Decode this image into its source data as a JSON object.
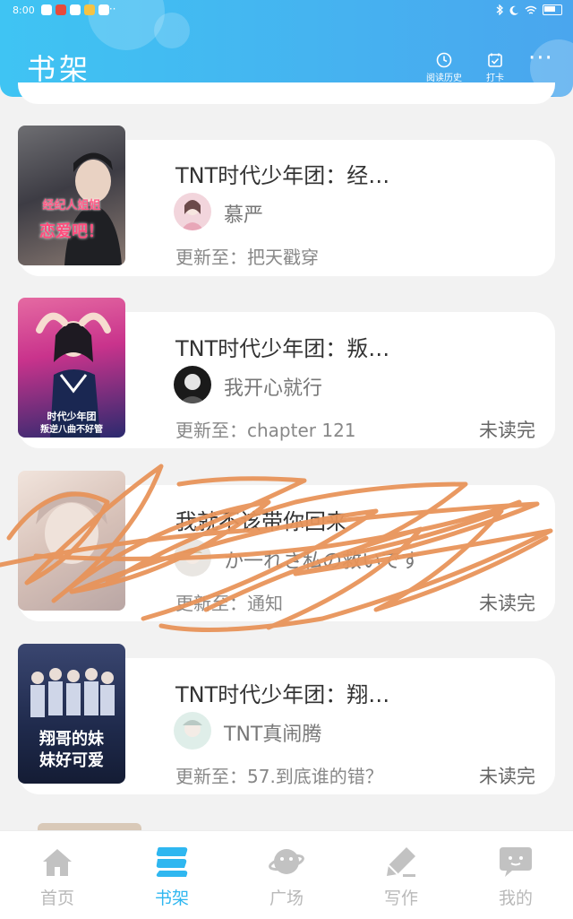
{
  "status_bar": {
    "time": "8:00",
    "more": "···"
  },
  "header": {
    "title": "书架",
    "history_label": "阅读历史",
    "checkin_label": "打卡",
    "more_icon": "more-dots-icon"
  },
  "books": [
    {
      "title": "TNT时代少年团：经…",
      "author": "慕严",
      "update": "更新至：把天戳穿",
      "status": "",
      "cover_text": [
        "经纪人姐姐",
        "恋爱吧！"
      ]
    },
    {
      "title": "TNT时代少年团：叛…",
      "author": "我开心就行",
      "update": "更新至：chapter 121",
      "status": "未读完",
      "cover_text": [
        "时代少年团",
        "叛逆八曲不好管"
      ]
    },
    {
      "title": "我就不该带你回来",
      "author": "か一れさ私の救いです",
      "update": "更新至：通知",
      "status": "未读完",
      "cover_text": []
    },
    {
      "title": "TNT时代少年团：翔…",
      "author": "TNT真闹腾",
      "update": "更新至：57.到底谁的错？",
      "status": "未读完",
      "cover_text": [
        "翔哥的妹",
        "妹好可爱"
      ]
    }
  ],
  "tabs": [
    {
      "label": "首页",
      "icon": "home-icon",
      "active": false
    },
    {
      "label": "书架",
      "icon": "bookshelf-icon",
      "active": true
    },
    {
      "label": "广场",
      "icon": "planet-icon",
      "active": false
    },
    {
      "label": "写作",
      "icon": "pen-icon",
      "active": false
    },
    {
      "label": "我的",
      "icon": "chat-bubble-icon",
      "active": false
    }
  ],
  "colors": {
    "header_start": "#3fc4f3",
    "header_end": "#4aa6ee",
    "tab_active": "#2fb7f0",
    "tab_inactive": "#b9b9b9",
    "scribble": "#e8945a"
  }
}
